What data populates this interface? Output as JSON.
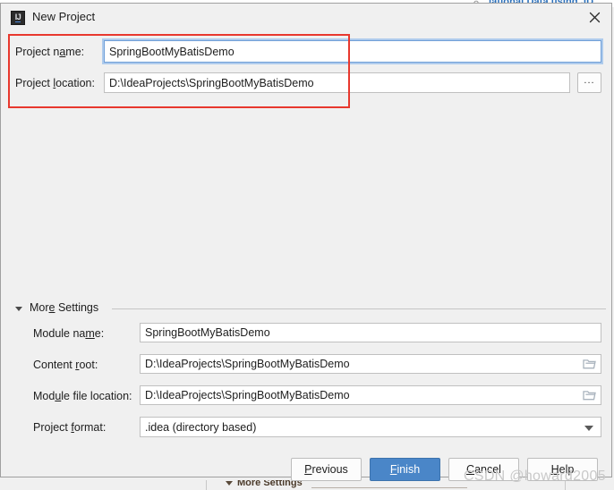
{
  "background": {
    "top_link_text": "lational Data using JD",
    "gear_icon": "gear-icon",
    "bottom_more_settings_label": "More Settings"
  },
  "dialog": {
    "title": "New Project",
    "app_icon": "IJ",
    "close_icon": "close-icon"
  },
  "form": {
    "project_name": {
      "label_prefix": "Project n",
      "label_mnemonic": "a",
      "label_suffix": "me:",
      "value": "SpringBootMyBatisDemo",
      "focused": true
    },
    "project_location": {
      "label_prefix": "Project ",
      "label_mnemonic": "l",
      "label_suffix": "ocation:",
      "value": "D:\\IdeaProjects\\SpringBootMyBatisDemo"
    },
    "browse_button_label": "...",
    "annotation_color": "#e8382e"
  },
  "more_settings": {
    "label_prefix": "Mor",
    "label_mnemonic": "e",
    "label_suffix": " Settings",
    "expanded": true,
    "fields": {
      "module_name": {
        "label_prefix": "Module na",
        "label_mnemonic": "m",
        "label_suffix": "e:",
        "value": "SpringBootMyBatisDemo"
      },
      "content_root": {
        "label_prefix": "Content ",
        "label_mnemonic": "r",
        "label_suffix": "oot:",
        "value": "D:\\IdeaProjects\\SpringBootMyBatisDemo",
        "icon": "folder-icon"
      },
      "module_file_location": {
        "label_prefix": "Mod",
        "label_mnemonic": "u",
        "label_suffix": "le file location:",
        "value": "D:\\IdeaProjects\\SpringBootMyBatisDemo",
        "icon": "folder-icon"
      },
      "project_format": {
        "label_prefix": "Project ",
        "label_mnemonic": "f",
        "label_suffix": "ormat:",
        "value": ".idea (directory based)",
        "icon": "chevron-down-icon"
      }
    }
  },
  "footer": {
    "previous": {
      "prefix": "",
      "mnemonic": "P",
      "suffix": "revious"
    },
    "finish": {
      "prefix": "",
      "mnemonic": "F",
      "suffix": "inish"
    },
    "cancel": {
      "prefix": "",
      "mnemonic": "C",
      "suffix": "ancel"
    },
    "help": {
      "prefix": "",
      "mnemonic": "H",
      "suffix": "elp"
    },
    "primary_color": "#4a86c8"
  },
  "watermark": "CSDN @howard2005"
}
